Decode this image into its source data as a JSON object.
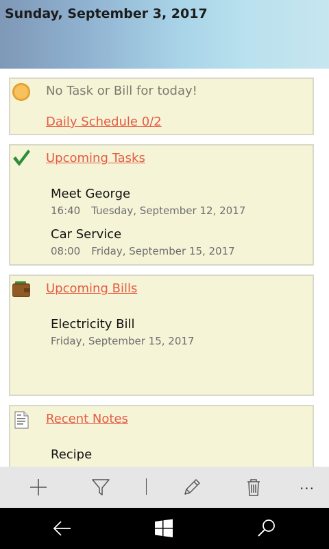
{
  "header": {
    "date": "Sunday, September 3, 2017"
  },
  "today": {
    "message": "No Task or Bill for today!",
    "schedule_link": "Daily Schedule 0/2",
    "icon": "sun-icon"
  },
  "tasks": {
    "heading": "Upcoming Tasks",
    "icon": "checkmark-icon",
    "items": [
      {
        "title": "Meet George",
        "time": "16:40",
        "date": "Tuesday, September 12, 2017"
      },
      {
        "title": "Car Service",
        "time": "08:00",
        "date": "Friday, September 15, 2017"
      }
    ]
  },
  "bills": {
    "heading": "Upcoming Bills",
    "icon": "wallet-icon",
    "items": [
      {
        "title": "Electricity Bill",
        "date": "Friday, September 15, 2017"
      }
    ]
  },
  "notes": {
    "heading": "Recent Notes",
    "icon": "note-icon",
    "items": [
      {
        "title": "Recipe"
      }
    ]
  },
  "appbar": {
    "buttons": [
      "add-icon",
      "filter-icon",
      "edit-icon",
      "delete-icon",
      "more-icon"
    ],
    "more_label": "..."
  },
  "navbar": {
    "buttons": [
      "back-icon",
      "windows-start-icon",
      "search-icon"
    ]
  },
  "colors": {
    "card_bg": "#f6f4d7",
    "link": "#e35b42",
    "appbar_bg": "#e6e6e6"
  }
}
